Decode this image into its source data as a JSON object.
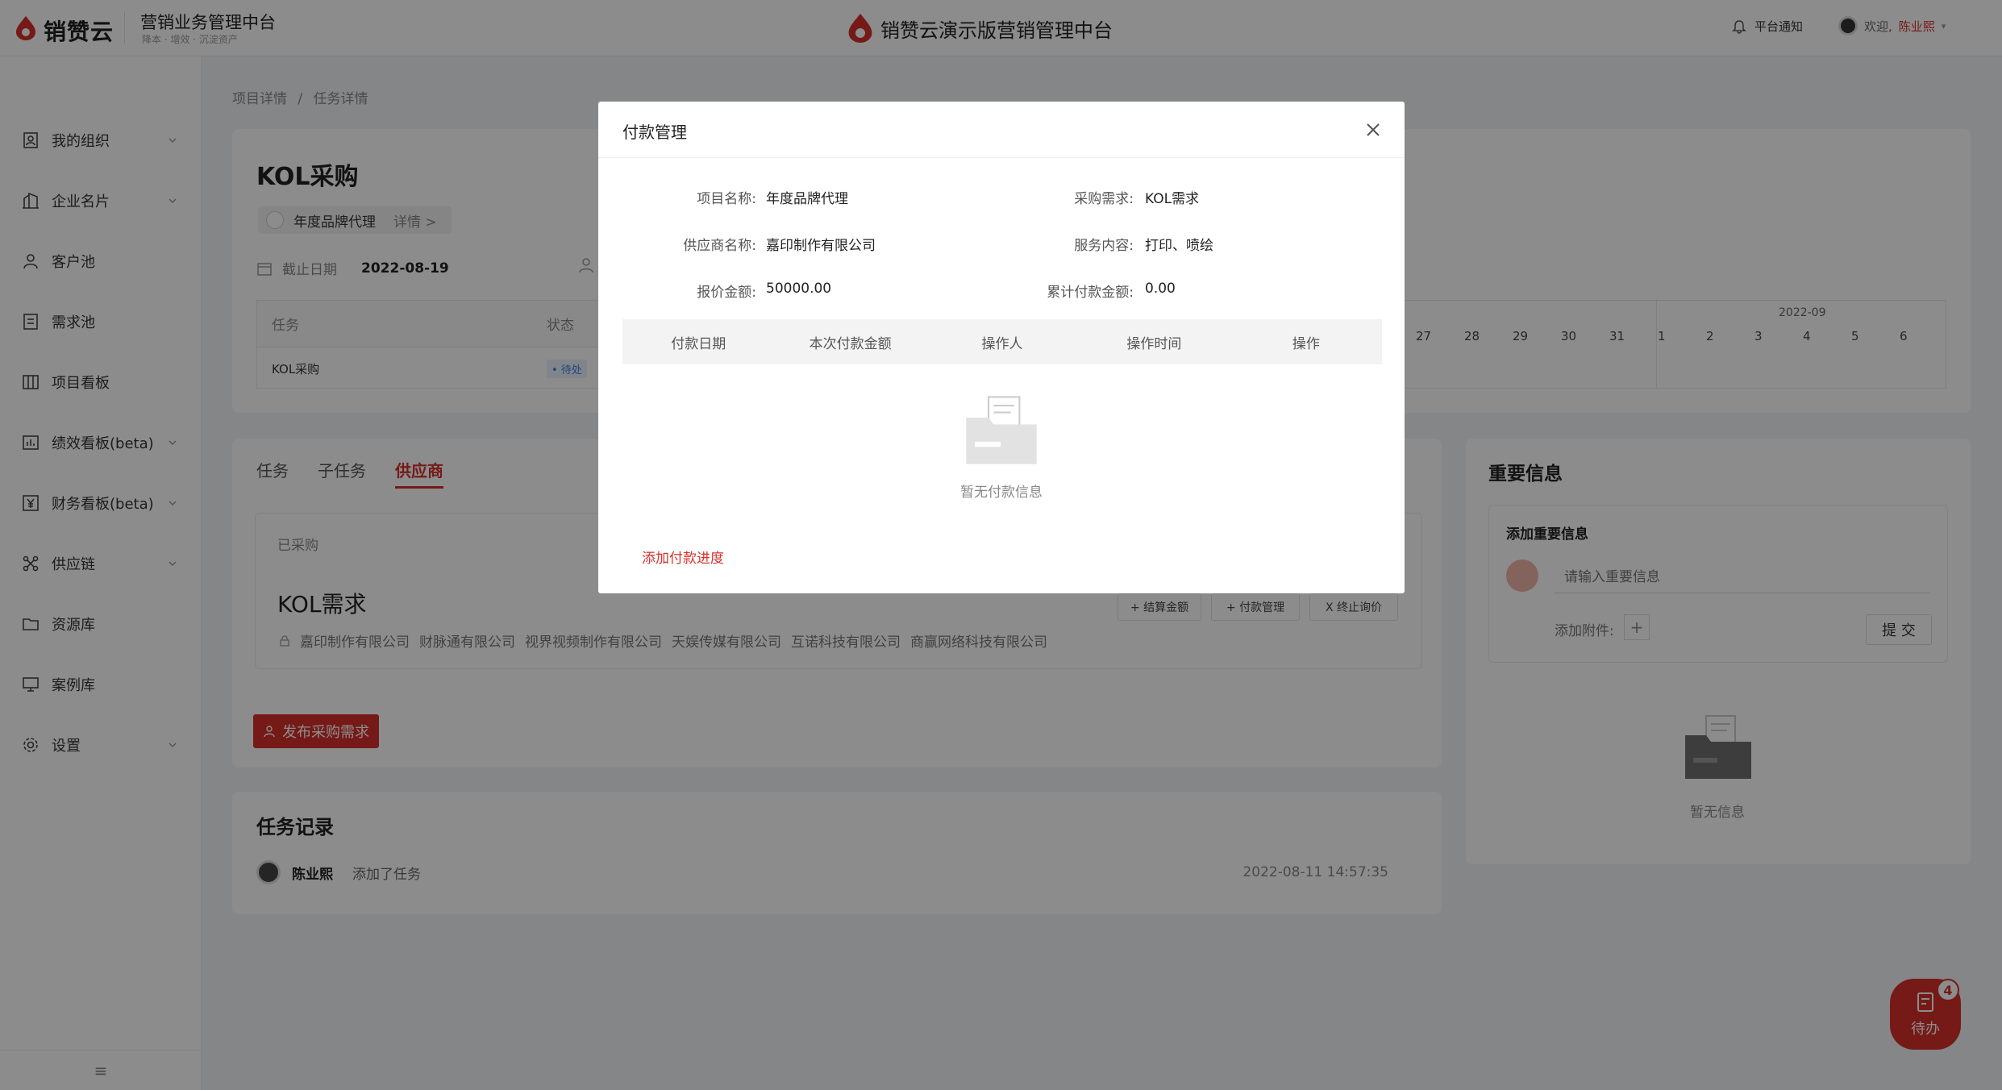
{
  "header": {
    "logo_text": "销赞云",
    "platform_title": "营销业务管理中台",
    "platform_sub": "降本 · 增效 · 沉淀资产",
    "center_title": "销赞云演示版营销管理中台",
    "notify_label": "平台通知",
    "welcome": "欢迎,",
    "username": "陈业熙"
  },
  "sidebar": {
    "items": [
      {
        "label": "我的组织",
        "icon": "org-icon",
        "has_arrow": true
      },
      {
        "label": "企业名片",
        "icon": "building-icon",
        "has_arrow": true
      },
      {
        "label": "客户池",
        "icon": "person-icon",
        "has_arrow": false
      },
      {
        "label": "需求池",
        "icon": "list-icon",
        "has_arrow": false
      },
      {
        "label": "项目看板",
        "icon": "board-icon",
        "has_arrow": false
      },
      {
        "label": "绩效看板(beta)",
        "icon": "chart-icon",
        "has_arrow": true
      },
      {
        "label": "财务看板(beta)",
        "icon": "yen-icon",
        "has_arrow": true
      },
      {
        "label": "供应链",
        "icon": "network-icon",
        "has_arrow": true
      },
      {
        "label": "资源库",
        "icon": "folder-icon",
        "has_arrow": false
      },
      {
        "label": "案例库",
        "icon": "screen-icon",
        "has_arrow": false
      },
      {
        "label": "设置",
        "icon": "gear-icon",
        "has_arrow": true
      }
    ],
    "collapse_icon": "menu-collapse-icon"
  },
  "breadcrumb": {
    "parent": "项目详情",
    "sep": "/",
    "current": "任务详情"
  },
  "task": {
    "title": "KOL采购",
    "project_name": "年度品牌代理",
    "detail_link": "详情 >",
    "deadline_label": "截止日期",
    "deadline_value": "2022-08-19"
  },
  "task_table": {
    "headers": [
      "任务",
      "状态"
    ],
    "row": {
      "task": "KOL采购",
      "status": "• 待处"
    }
  },
  "gantt": {
    "month": "2022-09",
    "days": [
      "27",
      "28",
      "29",
      "30",
      "31",
      "1",
      "2",
      "3",
      "4",
      "5",
      "6"
    ]
  },
  "tabs": [
    "任务",
    "子任务",
    "供应商"
  ],
  "active_tab": "供应商",
  "supplier_section": {
    "purchased_label": "已采购",
    "need_title": "KOL需求",
    "suppliers": [
      "嘉印制作有限公司",
      "财脉通有限公司",
      "视界视频制作有限公司",
      "天娱传媒有限公司",
      "互诺科技有限公司",
      "商赢网络科技有限公司"
    ],
    "btn_settle": "+ 结算金额",
    "btn_payment": "+ 付款管理",
    "btn_stop": "X 终止询价"
  },
  "publish_button": "发布采购需求",
  "task_log": {
    "title": "任务记录",
    "user": "陈业熙",
    "action": "添加了任务",
    "time": "2022-08-11 14:57:35"
  },
  "important_info": {
    "title": "重要信息",
    "add_label": "添加重要信息",
    "input_placeholder": "请输入重要信息",
    "attach_label": "添加附件:",
    "submit_label": "提 交",
    "empty_text": "暂无信息"
  },
  "todo": {
    "label": "待办",
    "badge": "4"
  },
  "modal": {
    "title": "付款管理",
    "fields": {
      "project_name_label": "项目名称:",
      "project_name_value": "年度品牌代理",
      "purchase_need_label": "采购需求:",
      "purchase_need_value": "KOL需求",
      "supplier_label": "供应商名称:",
      "supplier_value": "嘉印制作有限公司",
      "service_label": "服务内容:",
      "service_value": "打印、喷绘",
      "quote_label": "报价金额:",
      "quote_value": "50000.00",
      "paid_label": "累计付款金额:",
      "paid_value": "0.00"
    },
    "table_headers": [
      "付款日期",
      "本次付款金额",
      "操作人",
      "操作时间",
      "操作"
    ],
    "empty_text": "暂无付款信息",
    "add_progress": "添加付款进度"
  },
  "colors": {
    "brand_red": "#d6312b",
    "overlay": "rgba(0,0,0,0.45)"
  }
}
